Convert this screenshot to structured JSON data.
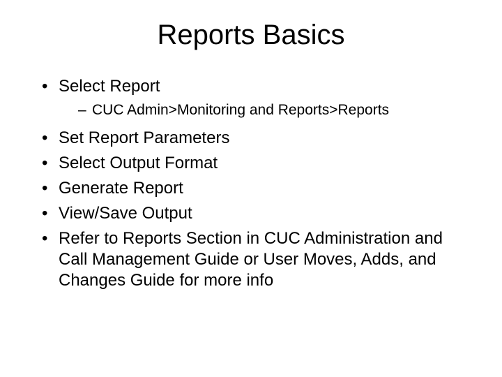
{
  "title": "Reports Basics",
  "bullets": [
    {
      "text": "Select Report",
      "sub": [
        "CUC Admin>Monitoring and Reports>Reports"
      ]
    },
    {
      "text": "Set Report Parameters"
    },
    {
      "text": "Select Output Format"
    },
    {
      "text": "Generate Report"
    },
    {
      "text": "View/Save Output"
    },
    {
      "text": "Refer to Reports Section in CUC Administration and Call Management Guide or User Moves, Adds, and Changes Guide for more info"
    }
  ]
}
